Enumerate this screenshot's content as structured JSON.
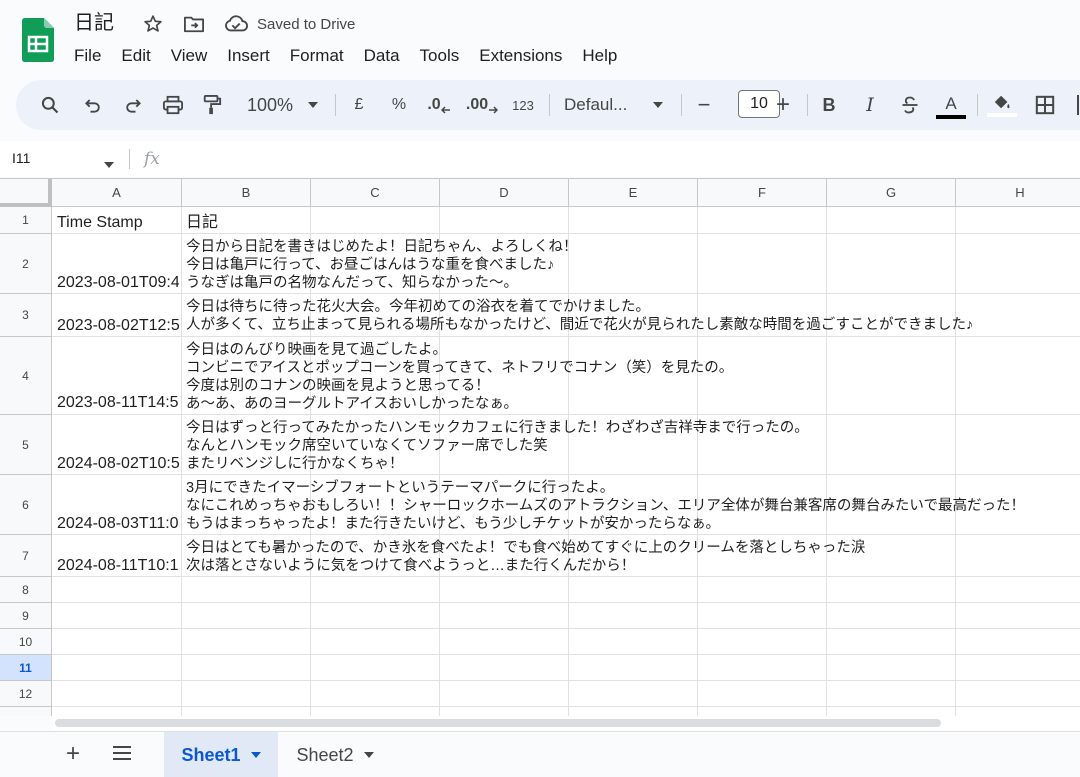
{
  "app": {
    "doc_title": "日記",
    "saved_status": "Saved to Drive"
  },
  "menu": [
    "File",
    "Edit",
    "View",
    "Insert",
    "Format",
    "Data",
    "Tools",
    "Extensions",
    "Help"
  ],
  "toolbar": {
    "zoom": "100%",
    "currency": "£",
    "percent": "%",
    "decrease_decimal": ".0",
    "increase_decimal": ".00",
    "number_format": "123",
    "font": "Defaul...",
    "minus": "−",
    "font_size": "10",
    "plus": "+",
    "bold": "B",
    "italic": "I",
    "text_color": "A",
    "text_color_value": "#000000"
  },
  "formula_bar": {
    "name_box": "I11",
    "fx": "fx"
  },
  "grid": {
    "columns": [
      "A",
      "B",
      "C",
      "D",
      "E",
      "F",
      "G",
      "H"
    ],
    "rows": [
      "1",
      "2",
      "3",
      "4",
      "5",
      "6",
      "7",
      "8",
      "9",
      "10",
      "11",
      "12"
    ],
    "selected_row": "11",
    "header": {
      "timestamp": "Time Stamp",
      "diary": "日記"
    },
    "entries": [
      {
        "timestamp": "2023-08-01T09:4",
        "lines": [
          "今日から日記を書きはじめたよ！日記ちゃん、よろしくね！",
          "今日は亀戸に行って、お昼ごはんはうな重を食べました♪",
          "うなぎは亀戸の名物なんだって、知らなかった〜。"
        ]
      },
      {
        "timestamp": "2023-08-02T12:5",
        "lines": [
          "今日は待ちに待った花火大会。今年初めての浴衣を着てでかけました。",
          "人が多くて、立ち止まって見られる場所もなかったけど、間近で花火が見られたし素敵な時間を過ごすことができました♪"
        ]
      },
      {
        "timestamp": "2023-08-11T14:5",
        "lines": [
          "今日はのんびり映画を見て過ごしたよ。",
          "コンビニでアイスとポップコーンを買ってきて、ネトフリでコナン（笑）を見たの。",
          "今度は別のコナンの映画を見ようと思ってる！",
          "あ〜あ、あのヨーグルトアイスおいしかったなぁ。"
        ]
      },
      {
        "timestamp": "2024-08-02T10:5",
        "lines": [
          "今日はずっと行ってみたかったハンモックカフェに行きました！わざわざ吉祥寺まで行ったの。",
          "なんとハンモック席空いていなくてソファー席でした笑",
          "またリベンジしに行かなくちゃ！"
        ]
      },
      {
        "timestamp": "2024-08-03T11:0",
        "lines": [
          "3月にできたイマーシブフォートというテーマパークに行ったよ。",
          "なにこれめっちゃおもしろい！！シャーロックホームズのアトラクション、エリア全体が舞台兼客席の舞台みたいで最高だった！",
          "もうはまっちゃったよ！また行きたいけど、もう少しチケットが安かったらなぁ。"
        ]
      },
      {
        "timestamp": "2024-08-11T10:1",
        "lines": [
          "今日はとても暑かったので、かき氷を食べたよ！でも食べ始めてすぐに上のクリームを落としちゃった涙",
          "次は落とさないように気をつけて食べようっと…また行くんだから！"
        ]
      }
    ]
  },
  "sheets": {
    "tabs": [
      "Sheet1",
      "Sheet2"
    ],
    "active": "Sheet1",
    "add": "+"
  },
  "colors": {
    "accent": "#0b57d0",
    "logo_green": "#0f9d58",
    "toolbar_bg": "#edf2fa"
  }
}
